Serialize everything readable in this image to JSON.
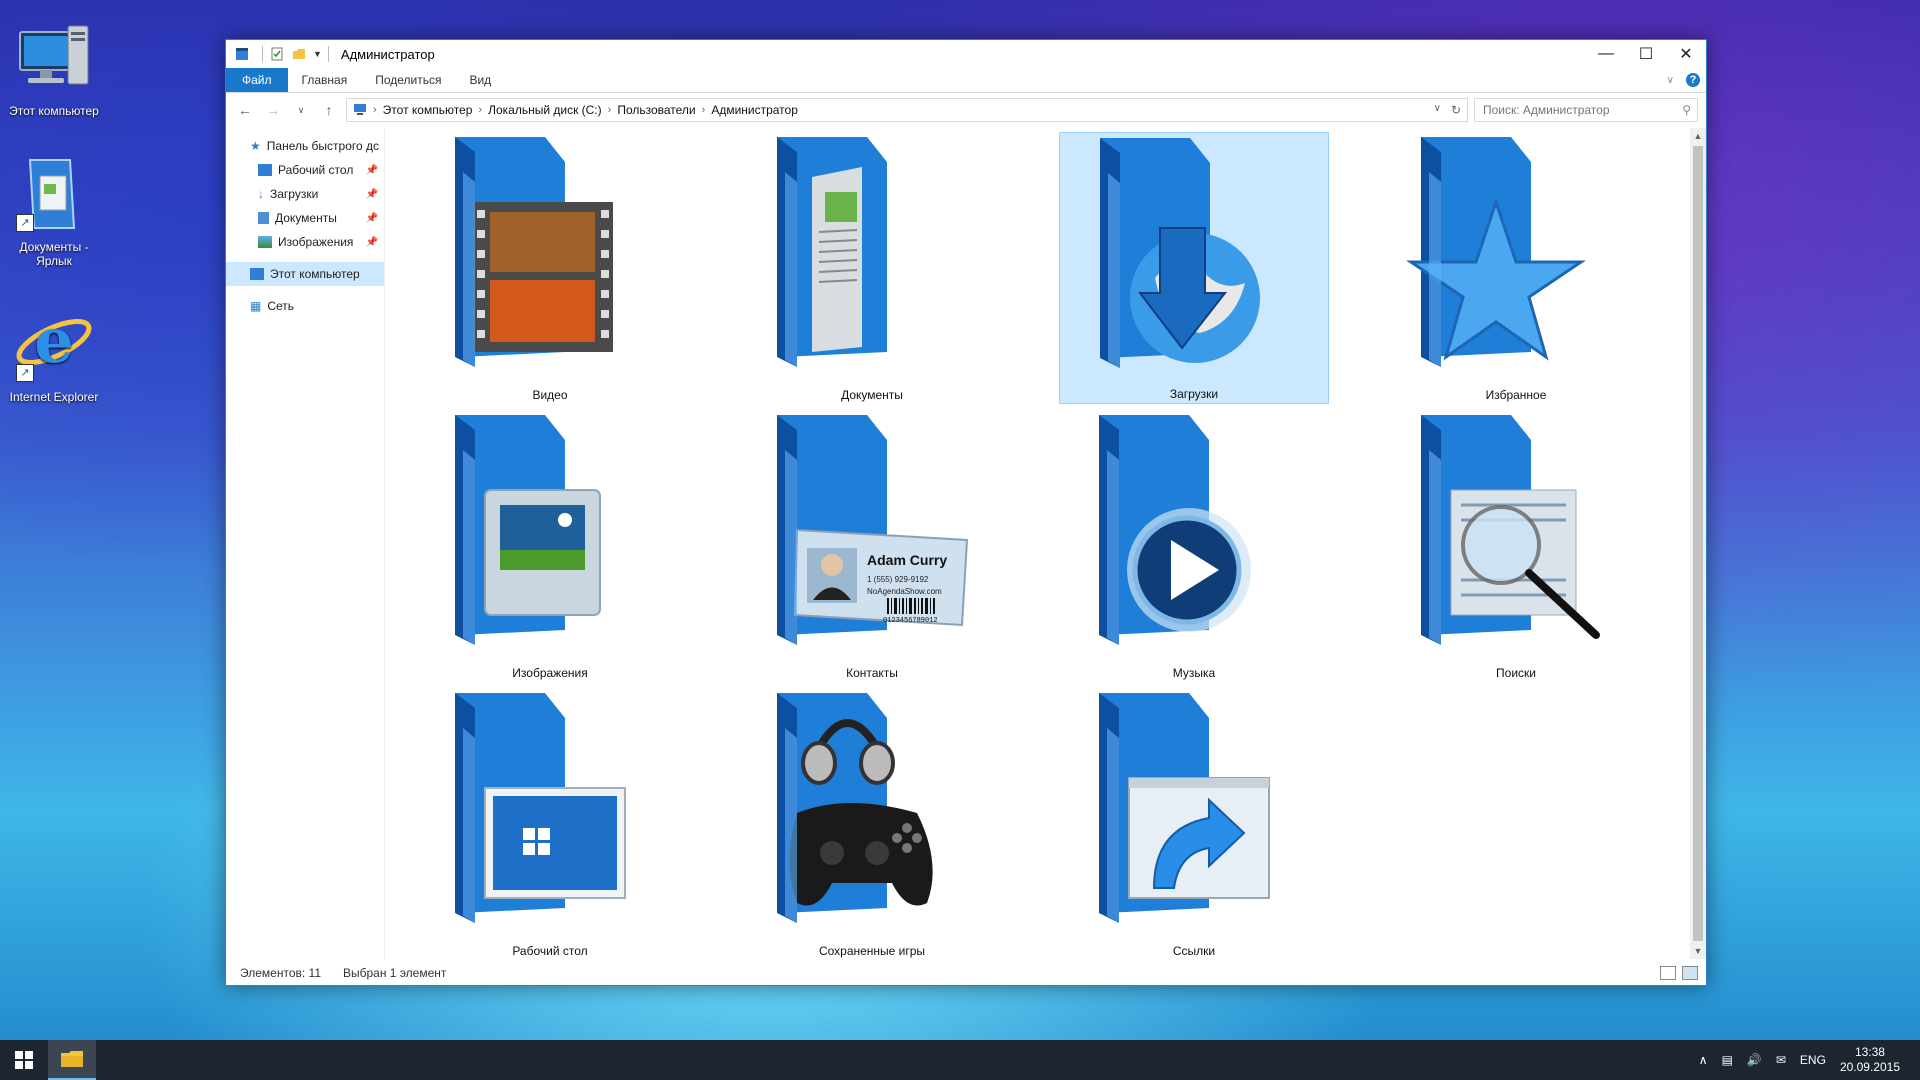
{
  "desktop": {
    "icons": [
      {
        "label": "Этот компьютер"
      },
      {
        "label": "Документы - Ярлык"
      },
      {
        "label": "Internet Explorer"
      }
    ]
  },
  "window": {
    "title": "Администратор",
    "ribbon_tabs": [
      "Файл",
      "Главная",
      "Поделиться",
      "Вид"
    ],
    "help_label": "?",
    "breadcrumb": [
      "Этот компьютер",
      "Локальный диск (C:)",
      "Пользователи",
      "Администратор"
    ],
    "search_placeholder": "Поиск: Администратор",
    "nav_pane": {
      "quick_access": "Панель быстрого дс",
      "quick_items": [
        "Рабочий стол",
        "Загрузки",
        "Документы",
        "Изображения"
      ],
      "this_pc": "Этот компьютер",
      "network": "Сеть"
    },
    "folders": [
      {
        "label": "Видео",
        "icon": "video-folder-icon"
      },
      {
        "label": "Документы",
        "icon": "documents-folder-icon"
      },
      {
        "label": "Загрузки",
        "icon": "downloads-folder-icon",
        "selected": true
      },
      {
        "label": "Избранное",
        "icon": "favorites-folder-icon"
      },
      {
        "label": "Изображения",
        "icon": "pictures-folder-icon"
      },
      {
        "label": "Контакты",
        "icon": "contacts-folder-icon"
      },
      {
        "label": "Музыка",
        "icon": "music-folder-icon"
      },
      {
        "label": "Поиски",
        "icon": "searches-folder-icon"
      },
      {
        "label": "Рабочий стол",
        "icon": "desktop-folder-icon"
      },
      {
        "label": "Сохраненные игры",
        "icon": "saved-games-folder-icon"
      },
      {
        "label": "Ссылки",
        "icon": "links-folder-icon"
      }
    ],
    "contact_card": {
      "name": "Adam Curry",
      "phone": "1 (555) 929-9192",
      "site": "NoAgendaShow.com",
      "barcode": "0123456789012"
    },
    "status": {
      "count": "Элементов: 11",
      "selection": "Выбран 1 элемент"
    }
  },
  "taskbar": {
    "language": "ENG",
    "time": "13:38",
    "date": "20.09.2015"
  },
  "colors": {
    "accent": "#1979ca",
    "selection": "#cce8ff",
    "taskbar": "#1c2530"
  }
}
